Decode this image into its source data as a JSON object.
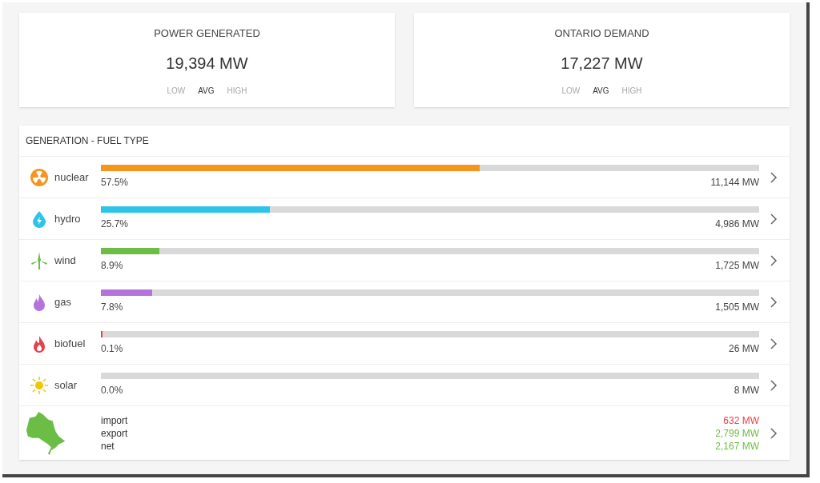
{
  "cards": [
    {
      "title": "POWER GENERATED",
      "value": "19,394 MW",
      "modes": [
        {
          "label": "LOW",
          "selected": false
        },
        {
          "label": "AVG",
          "selected": true
        },
        {
          "label": "HIGH",
          "selected": false
        }
      ]
    },
    {
      "title": "ONTARIO DEMAND",
      "value": "17,227 MW",
      "modes": [
        {
          "label": "LOW",
          "selected": false
        },
        {
          "label": "AVG",
          "selected": true
        },
        {
          "label": "HIGH",
          "selected": false
        }
      ]
    }
  ],
  "generation": {
    "title": "GENERATION - FUEL TYPE",
    "fuels": [
      {
        "kind": "nuclear",
        "name": "nuclear",
        "color": "#f7941d",
        "level": 0.575,
        "percent": "57.5%",
        "output": "11,144 MW"
      },
      {
        "kind": "hydro",
        "name": "hydro",
        "color": "#2ec4ea",
        "level": 0.257,
        "percent": "25.7%",
        "output": "4,986 MW"
      },
      {
        "kind": "wind",
        "name": "wind",
        "color": "#6cbd45",
        "level": 0.089,
        "percent": "8.9%",
        "output": "1,725 MW"
      },
      {
        "kind": "gas",
        "name": "gas",
        "color": "#b474dc",
        "level": 0.078,
        "percent": "7.8%",
        "output": "1,505 MW"
      },
      {
        "kind": "biofuel",
        "name": "biofuel",
        "color": "#e8404a",
        "level": 0.001,
        "percent": "0.1%",
        "output": "26 MW"
      },
      {
        "kind": "solar",
        "name": "solar",
        "color": "#f5c400",
        "level": 0.0,
        "percent": "0.0%",
        "output": "8 MW"
      }
    ],
    "trade": [
      {
        "label": "import",
        "value": "632 MW",
        "color": "#e8404a"
      },
      {
        "label": "export",
        "value": "2,799 MW",
        "color": "#6cbd45"
      },
      {
        "label": "net",
        "value": "2,167 MW",
        "color": "#6cbd45"
      }
    ]
  }
}
